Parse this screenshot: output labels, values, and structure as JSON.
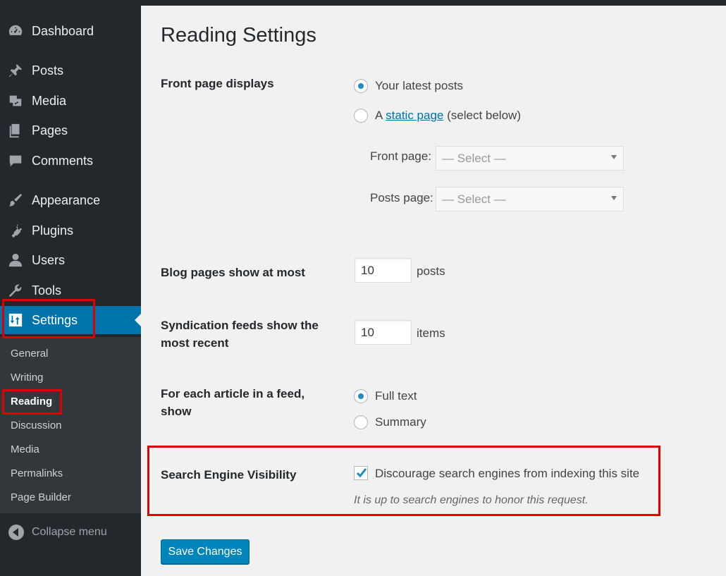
{
  "sidebar": {
    "items": [
      {
        "label": "Dashboard",
        "icon": "dashboard-icon"
      },
      {
        "label": "Posts",
        "icon": "pin-icon"
      },
      {
        "label": "Media",
        "icon": "media-icon"
      },
      {
        "label": "Pages",
        "icon": "pages-icon"
      },
      {
        "label": "Comments",
        "icon": "comment-icon"
      },
      {
        "label": "Appearance",
        "icon": "brush-icon"
      },
      {
        "label": "Plugins",
        "icon": "plug-icon"
      },
      {
        "label": "Users",
        "icon": "user-icon"
      },
      {
        "label": "Tools",
        "icon": "wrench-icon"
      },
      {
        "label": "Settings",
        "icon": "settings-icon"
      }
    ],
    "submenu": [
      "General",
      "Writing",
      "Reading",
      "Discussion",
      "Media",
      "Permalinks",
      "Page Builder"
    ],
    "collapse_label": "Collapse menu"
  },
  "main": {
    "title": "Reading Settings",
    "front_page": {
      "label": "Front page displays",
      "option_latest": "Your latest posts",
      "option_static_prefix": "A",
      "option_static_link": "static page",
      "option_static_suffix": "(select below)",
      "front_page_label": "Front page:",
      "posts_page_label": "Posts page:",
      "select_placeholder": "— Select —"
    },
    "blog_pages": {
      "label": "Blog pages show at most",
      "value": "10",
      "unit": "posts"
    },
    "syndication": {
      "label": "Syndication feeds show the most recent",
      "value": "10",
      "unit": "items"
    },
    "feed_article": {
      "label": "For each article in a feed, show",
      "option_full": "Full text",
      "option_summary": "Summary"
    },
    "search_engine": {
      "label": "Search Engine Visibility",
      "checkbox_label": "Discourage search engines from indexing this site",
      "description": "It is up to search engines to honor this request."
    },
    "save_label": "Save Changes"
  },
  "colors": {
    "accent": "#0073aa",
    "button": "#0085ba",
    "highlight": "#e00000",
    "menu_bg": "#23282d"
  }
}
